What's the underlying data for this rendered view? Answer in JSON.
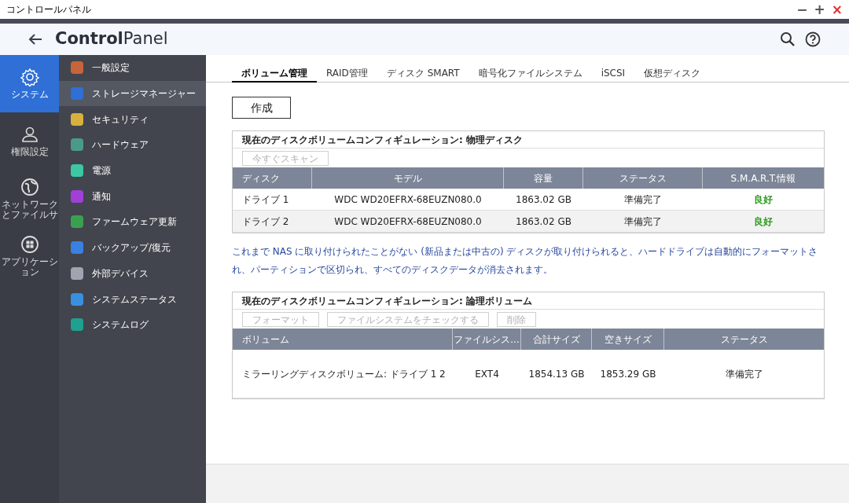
{
  "window": {
    "title": "コントロールパネル",
    "controls": [
      "−",
      "+",
      "×"
    ]
  },
  "header": {
    "title": "**Control**Panel"
  },
  "rail": [
    {
      "label": "システム",
      "selected": true
    },
    {
      "label": "権限設定",
      "selected": false
    },
    {
      "label": "ネットワークとファイルサ",
      "selected": false
    },
    {
      "label": "アプリケーション",
      "selected": false
    }
  ],
  "menu": [
    {
      "label": "一般設定",
      "color": "#c8643c",
      "selected": false
    },
    {
      "label": "ストレージマネージャー",
      "color": "#2f6fd6",
      "selected": true
    },
    {
      "label": "セキュリティ",
      "color": "#d8b040",
      "selected": false
    },
    {
      "label": "ハードウェア",
      "color": "#4a9a8a",
      "selected": false
    },
    {
      "label": "電源",
      "color": "#3cc8a0",
      "selected": false
    },
    {
      "label": "通知",
      "color": "#a040d8",
      "selected": false
    },
    {
      "label": "ファームウェア更新",
      "color": "#3aa050",
      "selected": false
    },
    {
      "label": "バックアップ/復元",
      "color": "#3a80e0",
      "selected": false
    },
    {
      "label": "外部デバイス",
      "color": "#a0a4b0",
      "selected": false
    },
    {
      "label": "システムステータス",
      "color": "#3a90e0",
      "selected": false
    },
    {
      "label": "システムログ",
      "color": "#20a090",
      "selected": false
    }
  ],
  "tabs": [
    {
      "label": "ボリューム管理",
      "selected": true
    },
    {
      "label": "RAID管理",
      "selected": false
    },
    {
      "label": "ディスク SMART",
      "selected": false
    },
    {
      "label": "暗号化ファイルシステム",
      "selected": false
    },
    {
      "label": "iSCSI",
      "selected": false
    },
    {
      "label": "仮想ディスク",
      "selected": false
    }
  ],
  "create_button": "作成",
  "physical": {
    "title": "現在のディスクボリュームコンフィギュレーション: 物理ディスク",
    "buttons": [
      {
        "label": "今すぐスキャン",
        "disabled": true
      }
    ],
    "columns": [
      "ディスク",
      "モデル",
      "容量",
      "ステータス",
      "S.M.A.R.T.情報"
    ],
    "rows": [
      [
        "ドライブ 1",
        "WDC WD20EFRX-68EUZN080.0",
        "1863.02 GB",
        "準備完了",
        "良好"
      ],
      [
        "ドライブ 2",
        "WDC WD20EFRX-68EUZN080.0",
        "1863.02 GB",
        "準備完了",
        "良好"
      ]
    ]
  },
  "notice": "これまで NAS に取り付けられたことがない (新品または中古の) ディスクが取り付けられると、ハードドライブは自動的にフォーマットされ、パーティションで区切られ、すべてのディスクデータが消去されます。",
  "logical": {
    "title": "現在のディスクボリュームコンフィギュレーション: 論理ボリューム",
    "buttons": [
      {
        "label": "フォーマット",
        "disabled": true
      },
      {
        "label": "ファイルシステムをチェックする",
        "disabled": true
      },
      {
        "label": "削除",
        "disabled": true
      }
    ],
    "columns": [
      "ボリューム",
      "ファイルシス...",
      "合計サイズ",
      "空きサイズ",
      "ステータス"
    ],
    "rows": [
      [
        "ミラーリングディスクボリューム: ドライブ 1 2",
        "EXT4",
        "1854.13 GB",
        "1853.29 GB",
        "準備完了"
      ]
    ]
  }
}
